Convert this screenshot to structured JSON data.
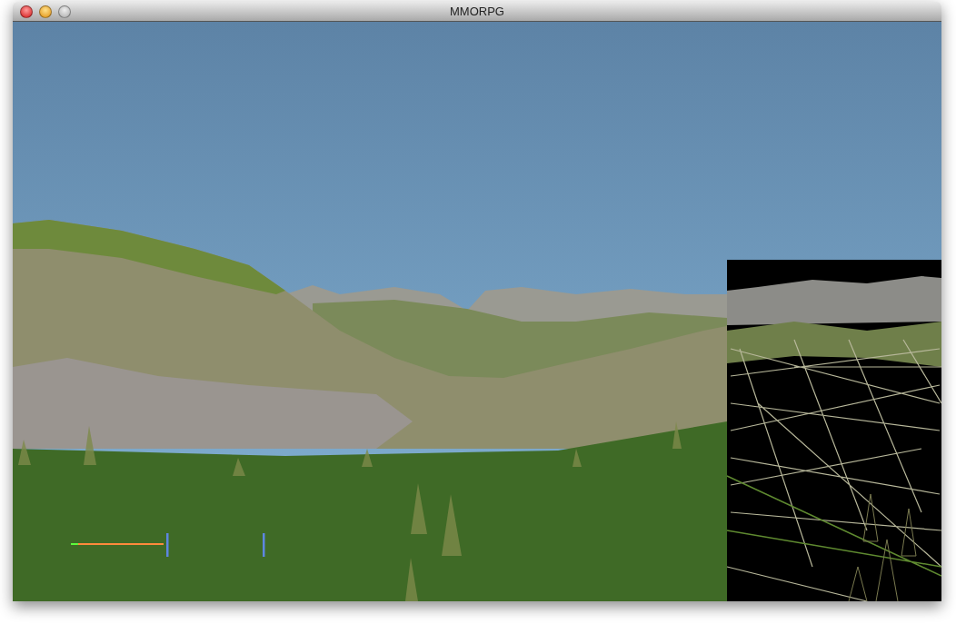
{
  "window": {
    "title": "MMORPG",
    "buttons": [
      {
        "kind": "close",
        "disabled": false
      },
      {
        "kind": "minimize",
        "disabled": false
      },
      {
        "kind": "zoom",
        "disabled": true
      }
    ]
  }
}
